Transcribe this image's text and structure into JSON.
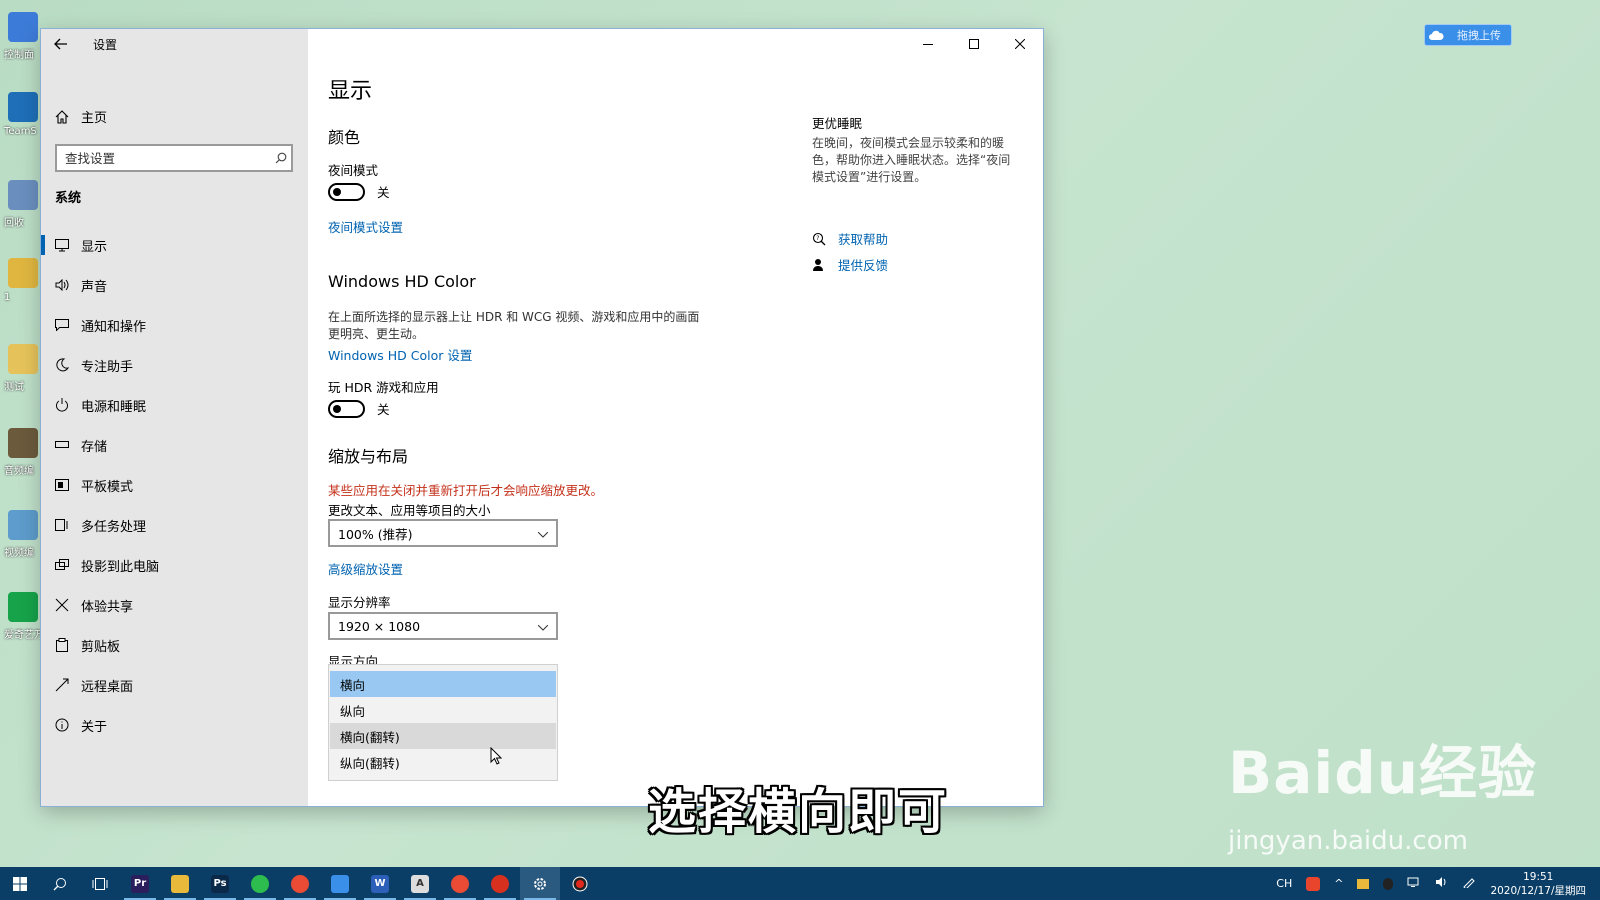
{
  "desktop": {
    "icons": [
      {
        "label": "控制面",
        "color": "#3d7bd8"
      },
      {
        "label": "TeamS",
        "color": "#1e6fb8"
      },
      {
        "label": "回收",
        "color": "#6a8fbf"
      },
      {
        "label": "1",
        "color": "#e0b640"
      },
      {
        "label": "测试",
        "color": "#e6c35a"
      },
      {
        "label": "音频编",
        "color": "#6c5a3c"
      },
      {
        "label": "视频编",
        "color": "#5d9ccc"
      },
      {
        "label": "爱奇艺万能",
        "color": "#17a34a"
      }
    ],
    "upload_badge": "拖拽上传"
  },
  "window": {
    "title": "设置",
    "sidebar": {
      "home": "主页",
      "search_placeholder": "查找设置",
      "section": "系统",
      "items": [
        {
          "label": "显示",
          "icon": "monitor-icon"
        },
        {
          "label": "声音",
          "icon": "speaker-icon"
        },
        {
          "label": "通知和操作",
          "icon": "notification-icon"
        },
        {
          "label": "专注助手",
          "icon": "moon-icon"
        },
        {
          "label": "电源和睡眠",
          "icon": "power-icon"
        },
        {
          "label": "存储",
          "icon": "storage-icon"
        },
        {
          "label": "平板模式",
          "icon": "tablet-icon"
        },
        {
          "label": "多任务处理",
          "icon": "multitask-icon"
        },
        {
          "label": "投影到此电脑",
          "icon": "project-icon"
        },
        {
          "label": "体验共享",
          "icon": "share-icon"
        },
        {
          "label": "剪贴板",
          "icon": "clipboard-icon"
        },
        {
          "label": "远程桌面",
          "icon": "remote-icon"
        },
        {
          "label": "关于",
          "icon": "info-icon"
        }
      ]
    },
    "main": {
      "title": "显示",
      "color_section": "颜色",
      "night_light_label": "夜间模式",
      "night_light_state": "关",
      "night_light_link": "夜间模式设置",
      "hdr_section": "Windows HD Color",
      "hdr_desc": "在上面所选择的显示器上让 HDR 和 WCG 视频、游戏和应用中的画面更明亮、更生动。",
      "hdr_link": "Windows HD Color 设置",
      "hdr_games_label": "玩 HDR 游戏和应用",
      "hdr_games_state": "关",
      "scale_section": "缩放与布局",
      "scale_warning": "某些应用在关闭并重新打开后才会响应缩放更改。",
      "scale_label": "更改文本、应用等项目的大小",
      "scale_value": "100% (推荐)",
      "advanced_scale_link": "高级缩放设置",
      "resolution_label": "显示分辨率",
      "resolution_value": "1920 × 1080",
      "orientation_label": "显示方向",
      "orientation_options": [
        "横向",
        "纵向",
        "横向(翻转)",
        "纵向(翻转)"
      ],
      "orientation_selected": "横向"
    },
    "right": {
      "title": "更优睡眠",
      "desc": "在晚间，夜间模式会显示较柔和的暖色，帮助你进入睡眠状态。选择“夜间模式设置”进行设置。",
      "get_help": "获取帮助",
      "feedback": "提供反馈"
    }
  },
  "caption": "选择横向即可",
  "watermark": {
    "main": "Baidu经验",
    "sub": "jingyan.baidu.com"
  },
  "taskbar": {
    "apps": [
      {
        "icon": "search-icon"
      },
      {
        "icon": "task-view-icon"
      },
      {
        "icon": "premiere-icon",
        "text": "Pr",
        "color": "#2a1f5c"
      },
      {
        "icon": "explorer-icon",
        "color": "#e8b93a"
      },
      {
        "icon": "photoshop-icon",
        "text": "Ps",
        "color": "#0b2a4a"
      },
      {
        "icon": "wechat-icon",
        "color": "#2dbd4e"
      },
      {
        "icon": "chrome-icon",
        "color": "#e94b35"
      },
      {
        "icon": "baidu-netdisk-icon",
        "color": "#3a8fe8"
      },
      {
        "icon": "word-icon",
        "text": "W",
        "color": "#2b5fb8"
      },
      {
        "icon": "autodesk-icon",
        "text": "A",
        "color": "#dddddd"
      },
      {
        "icon": "chrome-alt-icon",
        "color": "#e94b35"
      },
      {
        "icon": "netease-music-icon",
        "color": "#d8301f"
      },
      {
        "icon": "settings-icon",
        "color": "#0a3e66"
      },
      {
        "icon": "record-icon",
        "color": "#222222"
      }
    ],
    "tray": {
      "ime": "CH",
      "time": "19:51",
      "date": "2020/12/17/星期四"
    }
  }
}
